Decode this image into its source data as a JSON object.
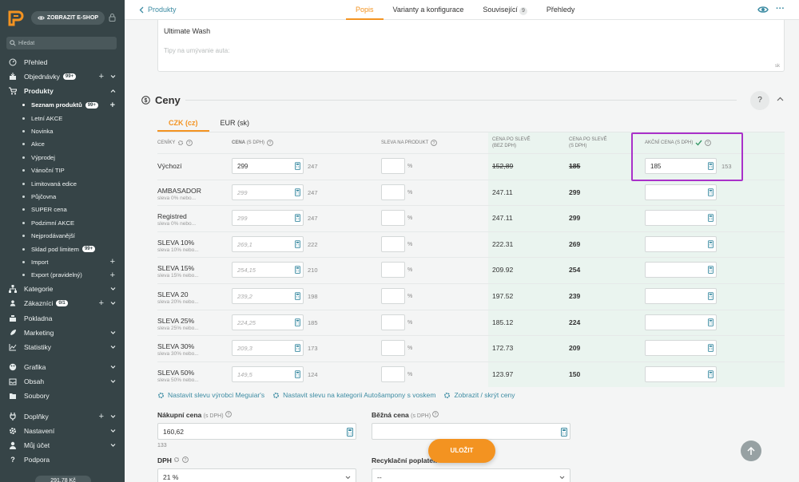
{
  "sidebar": {
    "eshop_button": "ZOBRAZIT E-SHOP",
    "search_placeholder": "Hledat",
    "items": [
      {
        "label": "Přehled",
        "icon": "gauge-icon"
      },
      {
        "label": "Objednávky",
        "badge": "99+",
        "icon": "box-icon"
      },
      {
        "label": "Produkty",
        "icon": "cart-icon"
      },
      {
        "label": "Kategorie",
        "icon": "sitemap-icon"
      },
      {
        "label": "Zákazníci",
        "badge": "0/1",
        "icon": "users-icon"
      },
      {
        "label": "Pokladna",
        "icon": "register-icon"
      },
      {
        "label": "Marketing",
        "icon": "rocket-icon"
      },
      {
        "label": "Statistiky",
        "icon": "chart-icon"
      },
      {
        "label": "Grafika",
        "icon": "palette-icon"
      },
      {
        "label": "Obsah",
        "icon": "inbox-icon"
      },
      {
        "label": "Soubory",
        "icon": "folder-icon"
      },
      {
        "label": "Doplňky",
        "icon": "plug-icon"
      },
      {
        "label": "Nastavení",
        "icon": "gear-icon"
      },
      {
        "label": "Můj účet",
        "icon": "user-icon"
      },
      {
        "label": "Podpora",
        "icon": "question-icon"
      }
    ],
    "product_sub": [
      {
        "label": "Seznam produktů",
        "badge": "99+"
      },
      {
        "label": "Letní AKCE"
      },
      {
        "label": "Novinka"
      },
      {
        "label": "Akce"
      },
      {
        "label": "Výprodej"
      },
      {
        "label": "Vánoční TIP"
      },
      {
        "label": "Limitovaná edice"
      },
      {
        "label": "Půjčovna"
      },
      {
        "label": "SUPER cena"
      },
      {
        "label": "Podzimní AKCE"
      },
      {
        "label": "Nejprodávanější"
      },
      {
        "label": "Sklad pod limitem",
        "badge": "99+"
      },
      {
        "label": "Import"
      },
      {
        "label": "Export (pravidelný)"
      }
    ],
    "bottom_pill": "291,78 Kč"
  },
  "topbar": {
    "back_label": "Produkty",
    "tabs": [
      {
        "label": "Popis"
      },
      {
        "label": "Varianty a konfigurace"
      },
      {
        "label": "Související",
        "count": "9"
      },
      {
        "label": "Přehledy"
      }
    ]
  },
  "description": {
    "line1": "Ultimate Wash",
    "line2": "Tipy na umývanie auta:",
    "lang": "sk"
  },
  "prices": {
    "title": "Ceny",
    "help": "?",
    "currency_tabs": [
      "CZK (cz)",
      "EUR (sk)"
    ],
    "headers": {
      "pricelists": "CENÍKY",
      "price": "CENA",
      "price_sub": "(S DPH)",
      "discount": "SLEVA NA PRODUKT",
      "after_net": "CENA PO SLEVĚ",
      "after_net_sub": "(BEZ DPH)",
      "after_gross": "CENA PO SLEVĚ",
      "after_gross_sub": "(S DPH)",
      "action": "AKČNÍ CENA",
      "action_sub": "(S DPH)"
    },
    "pct": "%",
    "rows": [
      {
        "name": "Výchozí",
        "sub": "",
        "price": "299",
        "net": "247",
        "after_net": "152,89",
        "after_gross": "185",
        "action": "185",
        "action_net": "153"
      },
      {
        "name": "AMBASADOR",
        "sub": "sleva 0% nebo...",
        "price": "299",
        "net": "247",
        "after_net": "247.11",
        "after_gross": "299",
        "action": "",
        "action_net": ""
      },
      {
        "name": "Registred",
        "sub": "sleva 0% nebo...",
        "price": "299",
        "net": "247",
        "after_net": "247.11",
        "after_gross": "299",
        "action": "",
        "action_net": ""
      },
      {
        "name": "SLEVA 10%",
        "sub": "sleva 10% nebo...",
        "price": "269,1",
        "net": "222",
        "after_net": "222.31",
        "after_gross": "269",
        "action": "",
        "action_net": ""
      },
      {
        "name": "SLEVA 15%",
        "sub": "sleva 15% nebo...",
        "price": "254,15",
        "net": "210",
        "after_net": "209.92",
        "after_gross": "254",
        "action": "",
        "action_net": ""
      },
      {
        "name": "SLEVA 20",
        "sub": "sleva 20% nebo...",
        "price": "239,2",
        "net": "198",
        "after_net": "197.52",
        "after_gross": "239",
        "action": "",
        "action_net": ""
      },
      {
        "name": "SLEVA 25%",
        "sub": "sleva 25% nebo...",
        "price": "224,25",
        "net": "185",
        "after_net": "185.12",
        "after_gross": "224",
        "action": "",
        "action_net": ""
      },
      {
        "name": "SLEVA 30%",
        "sub": "sleva 30% nebo...",
        "price": "209,3",
        "net": "173",
        "after_net": "172.73",
        "after_gross": "209",
        "action": "",
        "action_net": ""
      },
      {
        "name": "SLEVA 50%",
        "sub": "sleva 50% nebo...",
        "price": "149,5",
        "net": "124",
        "after_net": "123.97",
        "after_gross": "150",
        "action": "",
        "action_net": ""
      }
    ],
    "links": [
      "Nastavit slevu výrobci Meguiar's",
      "Nastavit slevu na kategorii Autošampony s voskem",
      "Zobrazit / skrýt ceny"
    ]
  },
  "purchase": {
    "label": "Nákupní cena",
    "sub": "(s DPH)",
    "value": "160,62",
    "note": "133"
  },
  "regular": {
    "label": "Běžná cena",
    "sub": "(s DPH)",
    "value": ""
  },
  "vat": {
    "label": "DPH",
    "value": "21 %"
  },
  "recycling": {
    "label": "Recyklační poplatek",
    "value": "--"
  },
  "save_label": "ULOŽIT",
  "colors": {
    "accent": "#f39321",
    "link": "#3d8ca3",
    "sidebar": "#364447",
    "highlight": "#a931c9"
  }
}
